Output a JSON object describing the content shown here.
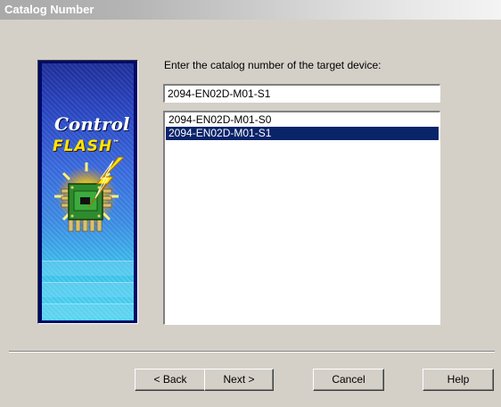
{
  "window": {
    "title": "Catalog Number"
  },
  "logo": {
    "line1": "Control",
    "line2": "FLASH",
    "trademark": "™"
  },
  "instruction": "Enter the catalog number of the target device:",
  "catalog_input": {
    "value": "2094-EN02D-M01-S1"
  },
  "catalog_list": {
    "items": [
      {
        "label": "2094-EN02D-M01-S0",
        "selected": false
      },
      {
        "label": "2094-EN02D-M01-S1",
        "selected": true
      }
    ]
  },
  "buttons": {
    "back": "< Back",
    "next": "Next >",
    "cancel": "Cancel",
    "help": "Help"
  },
  "colors": {
    "dialog_bg": "#d4d0c8",
    "selection": "#0a246a",
    "logo_frame": "#000a66",
    "logo_gold": "#ffe600"
  }
}
